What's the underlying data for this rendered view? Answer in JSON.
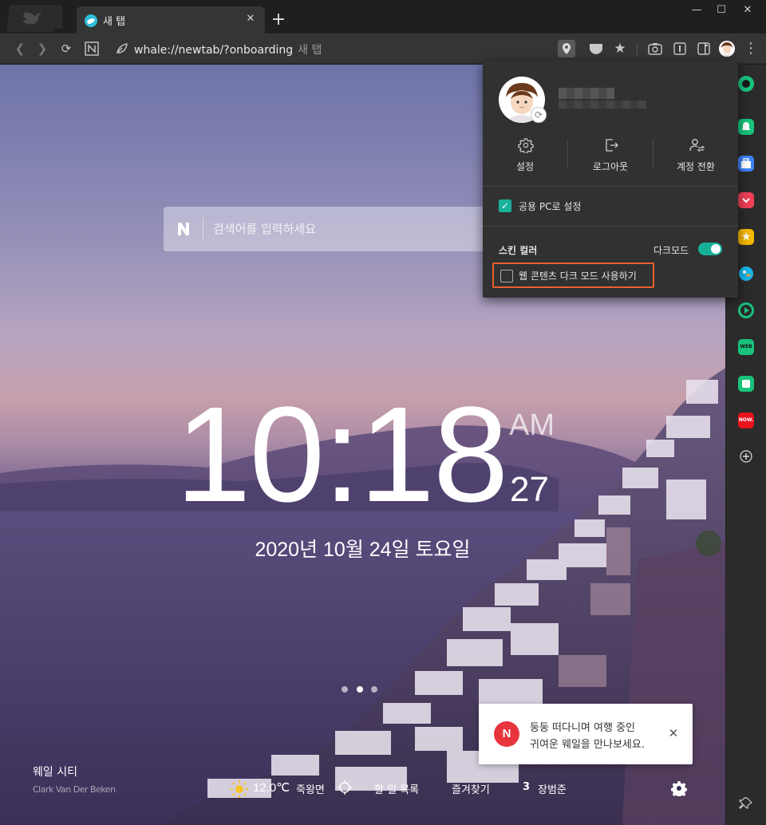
{
  "tab": {
    "title": "새 탭",
    "close": "✕"
  },
  "toolbar": {
    "url": "whale://newtab/?onboarding",
    "url_hint": "새 탭"
  },
  "window": {
    "minimize": "—",
    "maximize": "☐",
    "close": "✕"
  },
  "search": {
    "placeholder": "검색어를 입력하세요",
    "engine": "N"
  },
  "clock": {
    "time": "10:18",
    "ampm": "AM",
    "seconds": "27",
    "date": "2020년 10월 24일 토요일"
  },
  "slides": {
    "count": 3,
    "active": 1
  },
  "background": {
    "location": "웨일 시티",
    "credit": "Clark Van Der Beken"
  },
  "bottombar": {
    "temperature": "12.0℃",
    "location": "죽왕면",
    "todo": "할 일 목록",
    "bookmarks": "즐겨찾기",
    "count": "3",
    "name": "장범준"
  },
  "toast": {
    "icon": "N",
    "line1": "둥둥 떠다니며 여행 중인",
    "line2": "귀여운 웨일을 만나보세요.",
    "close": "✕"
  },
  "profile_menu": {
    "actions": [
      {
        "label": "설정",
        "icon": "gear-icon"
      },
      {
        "label": "로그아웃",
        "icon": "logout-icon"
      },
      {
        "label": "계정 전환",
        "icon": "switch-account-icon"
      }
    ],
    "public_pc": {
      "label": "공용 PC로 설정",
      "checked": true
    },
    "skin_color": "스킨 컬러",
    "dark_mode": {
      "label": "다크모드",
      "on": true
    },
    "web_dark": {
      "label": "웹 콘텐츠 다크 모드 사용하기",
      "checked": false
    }
  },
  "colors": {
    "accent": "#17b19a",
    "highlight": "#e8612c",
    "naver_red": "#e8343d"
  },
  "sidebar_apps": [
    "green-circle-icon",
    "notification-icon",
    "store-icon",
    "pocket-icon",
    "star-icon",
    "parrot-icon",
    "play-icon",
    "webtoon-icon",
    "green-square-icon",
    "now-icon"
  ]
}
